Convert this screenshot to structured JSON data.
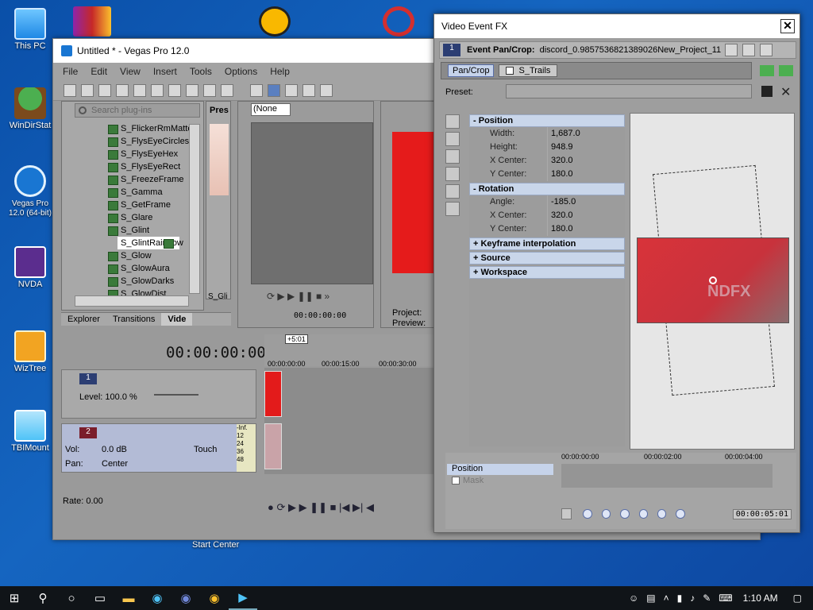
{
  "desktop": {
    "icons": [
      {
        "label": "This PC"
      },
      {
        "label": "WinDirStat"
      },
      {
        "label": "Vegas Pro 12.0 (64-bit)"
      },
      {
        "label": "NVDA"
      },
      {
        "label": "WizTree"
      },
      {
        "label": "TBIMount"
      }
    ],
    "start_center": "Start Center"
  },
  "vegas": {
    "title": "Untitled * - Vegas Pro 12.0",
    "menu": [
      "File",
      "Edit",
      "View",
      "Insert",
      "Tools",
      "Options",
      "Help"
    ],
    "search_placeholder": "Search plug-ins",
    "pres_label": "Pres",
    "preset_none": "(None",
    "plugins": [
      "S_FlickerRmMatte",
      "S_FlysEyeCircles",
      "S_FlysEyeHex",
      "S_FlysEyeRect",
      "S_FreezeFrame",
      "S_Gamma",
      "S_GetFrame",
      "S_Glare",
      "S_Glint",
      "S_GlintRainbow",
      "S_Glow",
      "S_GlowAura",
      "S_GlowDarks",
      "S_GlowDist"
    ],
    "selected_plugin": "S_GlintRainbow",
    "preview_label": "S_Gli",
    "tabs": [
      "Explorer",
      "Transitions",
      "Vide"
    ],
    "trimmer_time": "00:00:00:00",
    "project_label": "Project:",
    "preview_label2": "Preview:",
    "timecode": "00:00:00:00",
    "track1": {
      "num": "1",
      "level": "Level: 100.0 %"
    },
    "track2": {
      "num": "2",
      "vol_label": "Vol:",
      "vol": "0.0 dB",
      "pan_label": "Pan:",
      "pan": "Center",
      "mode": "Touch"
    },
    "meter": [
      "-Inf.",
      "12",
      "24",
      "36",
      "48"
    ],
    "ruler": [
      "00:00:00:00",
      "00:00:15:00",
      "00:00:30:00"
    ],
    "cursor_marker": "+5:01",
    "rate": "Rate: 0.00"
  },
  "fx": {
    "title": "Video Event FX",
    "chain_label": "Event Pan/Crop:",
    "chain_file": "discord_0.9857536821389026New_Project_11",
    "chain_num": "1",
    "tab_pancrop": "Pan/Crop",
    "tab_trails": "S_Trails",
    "preset_label": "Preset:",
    "sections": {
      "position": {
        "label": "Position",
        "rows": [
          {
            "k": "Width:",
            "v": "1,687.0"
          },
          {
            "k": "Height:",
            "v": "948.9"
          },
          {
            "k": "X Center:",
            "v": "320.0"
          },
          {
            "k": "Y Center:",
            "v": "180.0"
          }
        ]
      },
      "rotation": {
        "label": "Rotation",
        "rows": [
          {
            "k": "Angle:",
            "v": "-185.0"
          },
          {
            "k": "X Center:",
            "v": "320.0"
          },
          {
            "k": "Y Center:",
            "v": "180.0"
          }
        ]
      },
      "collapsed": [
        "Keyframe interpolation",
        "Source",
        "Workspace"
      ]
    },
    "preview_text": "NDFX",
    "kf_tracks": [
      "Position",
      "Mask"
    ],
    "kf_ruler": [
      "00:00:00:00",
      "00:00:02:00",
      "00:00:04:00"
    ],
    "kf_time": "00:00:05:01"
  },
  "taskbar": {
    "clock": "1:10 AM"
  },
  "colors": {
    "accent_red": "#e02020",
    "section_blue": "#c9d6ea"
  }
}
